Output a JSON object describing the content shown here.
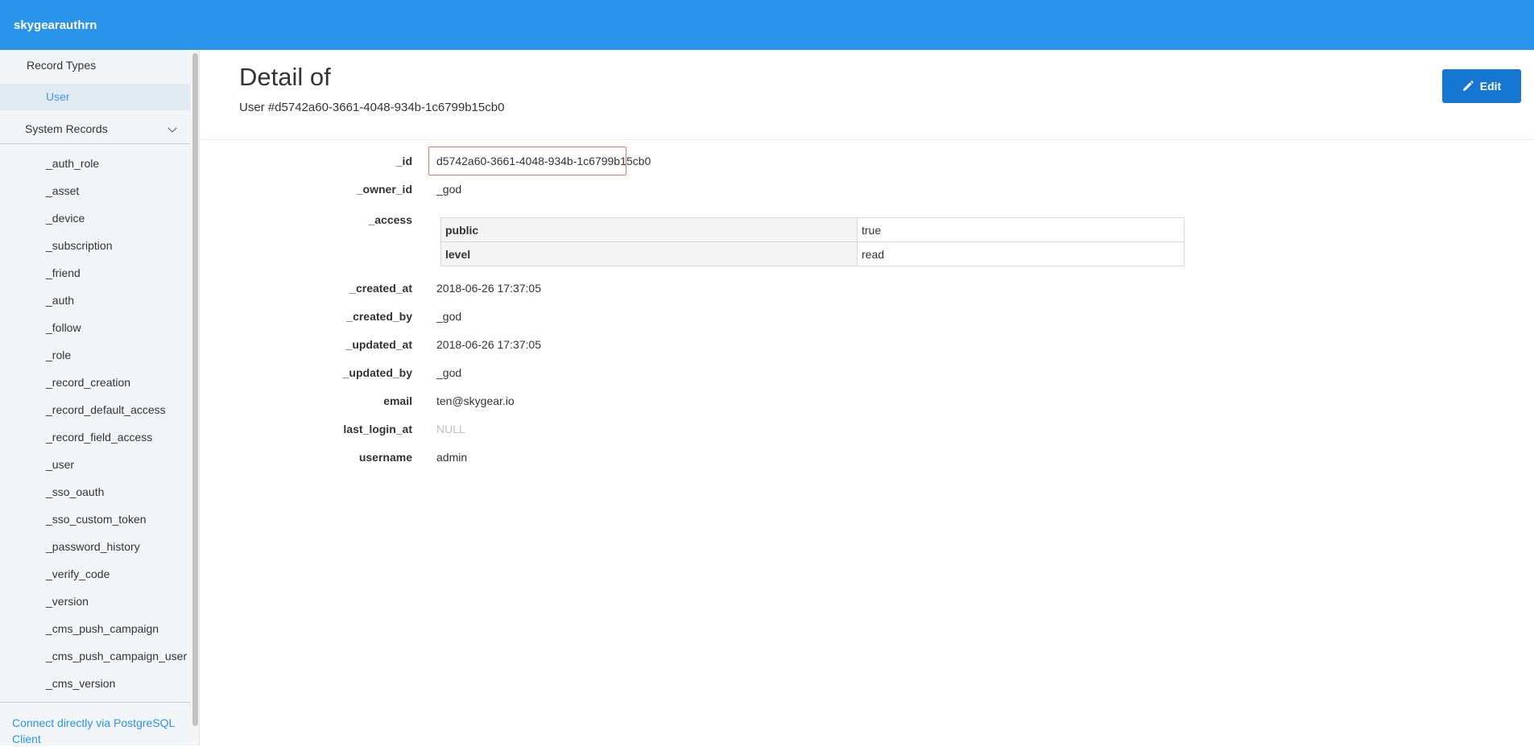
{
  "app": {
    "title": "skygearauthrn"
  },
  "sidebar": {
    "record_types_label": "Record Types",
    "record_types": [
      {
        "label": "User",
        "active": true
      }
    ],
    "system_records_label": "System Records",
    "system_records": [
      "_auth_role",
      "_asset",
      "_device",
      "_subscription",
      "_friend",
      "_auth",
      "_follow",
      "_role",
      "_record_creation",
      "_record_default_access",
      "_record_field_access",
      "_user",
      "_sso_oauth",
      "_sso_custom_token",
      "_password_history",
      "_verify_code",
      "_version",
      "_cms_push_campaign",
      "_cms_push_campaign_user",
      "_cms_version"
    ],
    "connect_link": "Connect directly via PostgreSQL Client"
  },
  "page": {
    "title": "Detail of",
    "subtitle": "User #d5742a60-3661-4048-934b-1c6799b15cb0",
    "edit_label": "Edit"
  },
  "fields": {
    "id": {
      "label": "_id",
      "value": "d5742a60-3661-4048-934b-1c6799b15cb0"
    },
    "owner_id": {
      "label": "_owner_id",
      "value": "_god"
    },
    "access": {
      "label": "_access",
      "rows": [
        {
          "key": "public",
          "value": "true"
        },
        {
          "key": "level",
          "value": "read"
        }
      ]
    },
    "created_at": {
      "label": "_created_at",
      "value": "2018-06-26 17:37:05"
    },
    "created_by": {
      "label": "_created_by",
      "value": "_god"
    },
    "updated_at": {
      "label": "_updated_at",
      "value": "2018-06-26 17:37:05"
    },
    "updated_by": {
      "label": "_updated_by",
      "value": "_god"
    },
    "email": {
      "label": "email",
      "value": "ten@skygear.io"
    },
    "last_login_at": {
      "label": "last_login_at",
      "value": "NULL"
    },
    "username": {
      "label": "username",
      "value": "admin"
    }
  },
  "colors": {
    "topbar": "#2a93ea",
    "accent": "#2a93ea",
    "edit_button": "#1677d2",
    "highlight_border": "#e8765e",
    "sidebar_bg": "#f2f5f8"
  },
  "icons": {
    "edit": "pencil-icon",
    "expand": "chevron-down-icon"
  }
}
